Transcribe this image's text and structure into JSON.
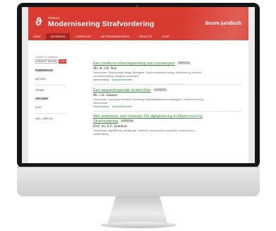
{
  "header": {
    "logo_mark": "ϑ",
    "platform": "Platform",
    "title": "Modernisering Strafvordering",
    "publisher": "Boom juridisch"
  },
  "nav": {
    "items": [
      {
        "label": "Home",
        "active": false
      },
      {
        "label": "Bijdragen",
        "active": true
      },
      {
        "label": "Literatuur",
        "active": false
      },
      {
        "label": "Wetgevingsdossier",
        "active": false
      },
      {
        "label": "Redactie",
        "active": false
      },
      {
        "label": "Over",
        "active": false
      }
    ]
  },
  "sidebar": {
    "search_label": "Zoeken in artikelen",
    "search_select": "GEHELE TEKST",
    "search_button": "ZOEK",
    "rubrieken_heading": "RUBRIEKEN",
    "rubrieken": [
      "ARTIKEL",
      "OPINIE"
    ],
    "archief_heading": "ARCHIEF",
    "archief": [
      "2018",
      "JAN - MAR (3)"
    ]
  },
  "articles": [
    {
      "title": "Een moderne inbeslagneming van voorwerpen",
      "title_line2": "",
      "date": "05/03/2018",
      "author": "Mr. dr. J.B. Nan",
      "keywords_line1": "Trefwoorden: Strafvorderlijk beslag, Beslagens, Onlsk conservatoir beslag, Modernisering Wetboek",
      "keywords_line2": "van Strafvordering, beslag op voorwerpen",
      "link_summary": "Samenvatting",
      "link_author": "Auteursinformatie"
    },
    {
      "title": "Een waarschuwende strafrechter",
      "title_line2": "",
      "date": "01/03/2018",
      "author": "Mr. J.H. Janssen",
      "keywords_line1": "Trefwoorden: Voorlopige hechtenis, Schorsing, Vrijheidsbeperkende maatregelen, Vrijheidsbeneming,",
      "keywords_line2": "Wetsvoorstel",
      "link_summary": "Samenvatting",
      "link_author": "Auteursinformatie"
    },
    {
      "title": "Wel ambitieus, niet visionair. De digitalisering in Modernisering",
      "title_line2": "Strafvordering",
      "date": "02/02/2018",
      "author": "Prof. mr. E.F. Stamhuis",
      "keywords_line1": "Trefwoorden: digitalisering, rechtspraak, strafrecht, man machine cooperation, modernisering",
      "keywords_line2": "strafvordering",
      "link_summary": "Samenvatting",
      "link_author": "Auteursinformatie"
    }
  ],
  "colors": {
    "brand_red": "#d83b31",
    "nav_active": "#a8261f",
    "link_green": "#3a8a3a"
  }
}
